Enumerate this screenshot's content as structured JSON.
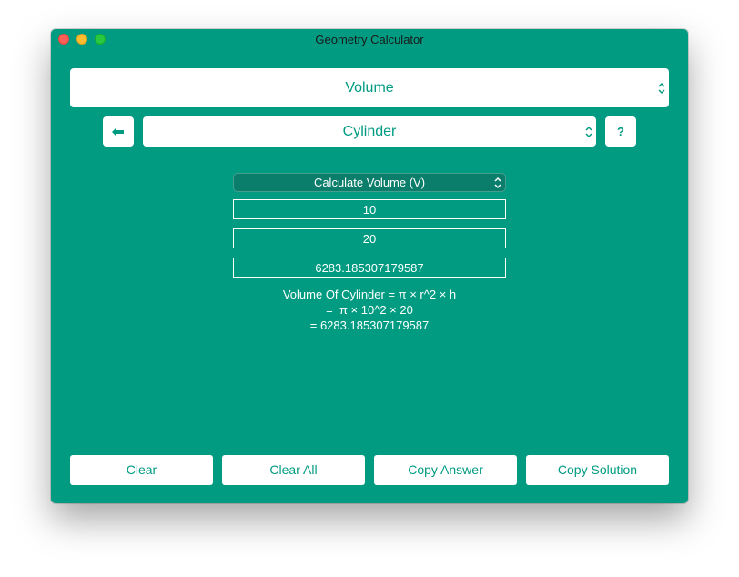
{
  "window": {
    "title": "Geometry Calculator"
  },
  "category_select": {
    "value": "Volume"
  },
  "shape_select": {
    "value": "Cylinder"
  },
  "back_button": {
    "icon": "arrow-left-icon"
  },
  "help_button": {
    "label": "?"
  },
  "calc_select": {
    "value": "Calculate Volume (V)"
  },
  "inputs": {
    "radius": "10",
    "height": "20",
    "result": "6283.185307179587"
  },
  "solution": {
    "line1": "Volume Of Cylinder = π × r^2 × h",
    "line2": "=  π × 10^2 × 20",
    "line3": "= 6283.185307179587"
  },
  "buttons": {
    "clear": "Clear",
    "clear_all": "Clear All",
    "copy_answer": "Copy Answer",
    "copy_solution": "Copy Solution"
  },
  "colors": {
    "background": "#019b82",
    "accent_text": "#019b82",
    "dark_select": "#0a7e6a"
  }
}
